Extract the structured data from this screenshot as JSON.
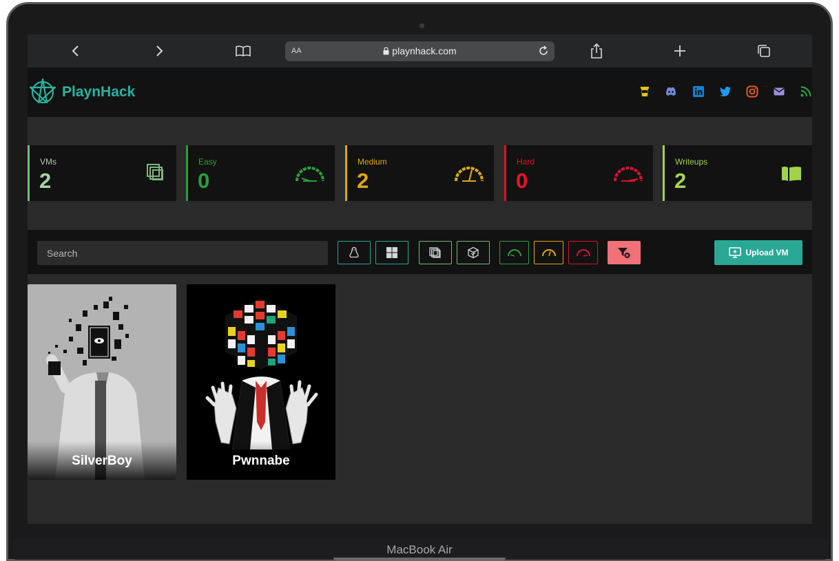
{
  "device": {
    "label": "MacBook Air"
  },
  "browser": {
    "address_aa": "AA",
    "url": "playnhack.com"
  },
  "header": {
    "brand": "PlaynHack",
    "social_icons": [
      "coffee-icon",
      "discord-icon",
      "linkedin-icon",
      "twitter-icon",
      "instagram-icon",
      "mail-icon",
      "rss-icon"
    ]
  },
  "stats": [
    {
      "label": "VMs",
      "value": "2",
      "color": "#7ab87a",
      "icon": "vms-icon"
    },
    {
      "label": "Easy",
      "value": "0",
      "color": "#2e9e3c",
      "icon": "gauge-easy-icon"
    },
    {
      "label": "Medium",
      "value": "2",
      "color": "#e0a80c",
      "icon": "gauge-medium-icon"
    },
    {
      "label": "Hard",
      "value": "0",
      "color": "#d9152a",
      "icon": "gauge-hard-icon"
    },
    {
      "label": "Writeups",
      "value": "2",
      "color": "#9fd44a",
      "icon": "book-icon"
    }
  ],
  "filters": {
    "search_placeholder": "Search",
    "buttons": [
      "linux-icon",
      "windows-icon",
      "vmware-icon",
      "virtualbox-icon",
      "gauge-easy-icon",
      "gauge-medium-icon",
      "gauge-hard-icon",
      "filter-clear-icon"
    ],
    "upload_label": "Upload VM"
  },
  "vms": [
    {
      "name": "SilverBoy"
    },
    {
      "name": "Pwnnabe"
    }
  ],
  "colors": {
    "accent": "#2aa896",
    "easy": "#2e9e3c",
    "medium": "#e0a80c",
    "hard": "#d9152a",
    "clear_filter": "#f07178"
  }
}
